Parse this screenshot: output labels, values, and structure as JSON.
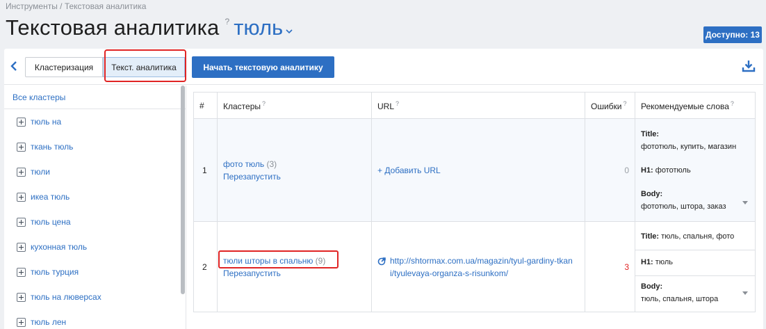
{
  "breadcrumb": "Инструменты / Текстовая аналитика",
  "page": {
    "title": "Текстовая аналитика",
    "help": "?",
    "keyword": "тюль"
  },
  "badge": "Доступно: 13",
  "toolbar": {
    "back_icon": "chevron-left-icon",
    "tab_cluster": "Кластеризация",
    "tab_text": "Текст. аналитика",
    "start_button": "Начать текстовую аналитику",
    "download_icon": "download-icon"
  },
  "sidebar": {
    "all": "Все кластеры",
    "items": [
      {
        "label": "тюль на"
      },
      {
        "label": "ткань тюль"
      },
      {
        "label": "тюли"
      },
      {
        "label": "икеа тюль"
      },
      {
        "label": "тюль цена"
      },
      {
        "label": "кухонная тюль"
      },
      {
        "label": "тюль турция"
      },
      {
        "label": "тюль на люверсах"
      },
      {
        "label": "тюль лен"
      }
    ]
  },
  "table": {
    "headers": {
      "num": "#",
      "clusters": "Кластеры",
      "url": "URL",
      "errors": "Ошибки",
      "recommended": "Рекомендуемые слова",
      "q": "?"
    },
    "rows": [
      {
        "num": "1",
        "cluster": "фото тюль",
        "count": "(3)",
        "rerun": "Перезапустить",
        "url_action": "+ Добавить URL",
        "errors": "0",
        "title_label": "Title:",
        "title_words": "фототюль, купить, магазин",
        "h1_label": "H1:",
        "h1_words": "фототюль",
        "body_label": "Body:",
        "body_words": "фототюль, штора, заказ"
      },
      {
        "num": "2",
        "cluster": "тюли шторы в спальню",
        "count": "(9)",
        "rerun": "Перезапустить",
        "url_line1": "http://shtormax.com.ua/magazin/tyul-gardiny-tkan",
        "url_line2": "i/tyulevaya-organza-s-risunkom/",
        "errors": "3",
        "title_label": "Title:",
        "title_words": "тюль, спальня, фото",
        "h1_label": "H1:",
        "h1_words": "тюль",
        "body_label": "Body:",
        "body_words": "тюль, спальня, штора"
      }
    ]
  },
  "colors": {
    "accent": "#2d6fc3",
    "error": "#e02424",
    "highlight": "#e02424"
  }
}
